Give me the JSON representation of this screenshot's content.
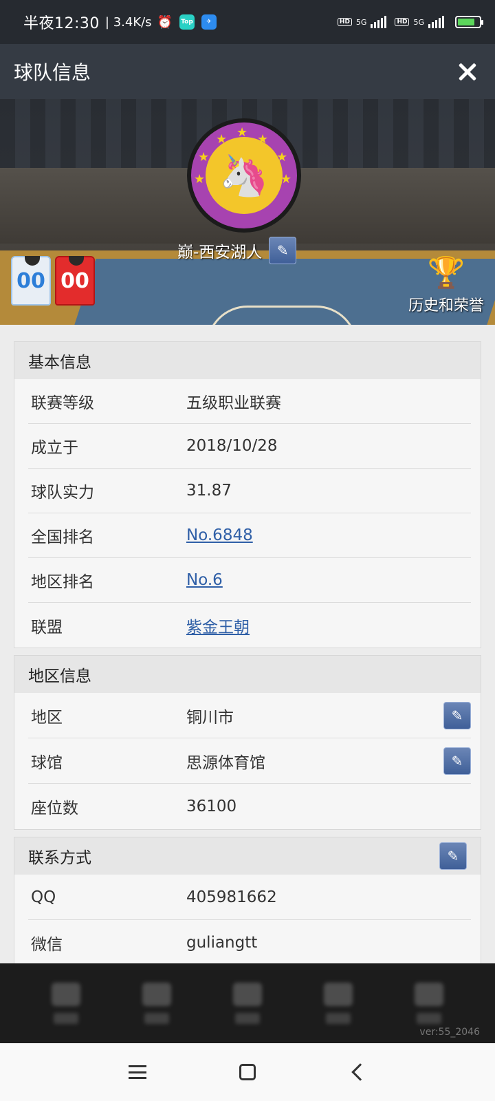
{
  "status_bar": {
    "time": "半夜12:30",
    "net_speed": "| 3.4K/s",
    "alarm_icon": "⏰",
    "app_badge_1": "Top",
    "app_badge_2": "✈",
    "hd_1": "HD",
    "sig_1": "5G",
    "hd_2": "HD",
    "sig_2": "5G"
  },
  "header": {
    "title": "球队信息"
  },
  "hero": {
    "team_name": "巅-西安湖人",
    "jersey_home_number": "00",
    "jersey_away_number": "00",
    "honor_label": "历史和荣誉",
    "logo_glyph": "🦄",
    "trophy_glyph": "🏆"
  },
  "basic_info": {
    "heading": "基本信息",
    "rows": [
      {
        "key": "联赛等级",
        "value": "五级职业联赛"
      },
      {
        "key": "成立于",
        "value": "2018/10/28"
      },
      {
        "key": "球队实力",
        "value": "31.87"
      },
      {
        "key": "全国排名",
        "value": "No.6848"
      },
      {
        "key": "地区排名",
        "value": "No.6"
      },
      {
        "key": "联盟",
        "value": "紫金王朝"
      }
    ]
  },
  "region_info": {
    "heading": "地区信息",
    "rows": [
      {
        "key": "地区",
        "value": "铜川市"
      },
      {
        "key": "球馆",
        "value": "思源体育馆"
      },
      {
        "key": "座位数",
        "value": "36100"
      }
    ]
  },
  "contact_info": {
    "heading": "联系方式",
    "rows": [
      {
        "key": "QQ",
        "value": "405981662"
      },
      {
        "key": "微信",
        "value": "guliangtt"
      }
    ]
  },
  "footer": {
    "version": "ver:55_2046"
  },
  "icons": {
    "edit": "✎"
  },
  "colors": {
    "link": "#2f5fa7",
    "titlebar": "#353b44",
    "edit_button": "#4f6fa8",
    "logo_ring": "#a743b0",
    "logo_inner": "#f3c62a",
    "jersey_red": "#e32c2c",
    "jersey_white_number": "#2d7ed8"
  }
}
